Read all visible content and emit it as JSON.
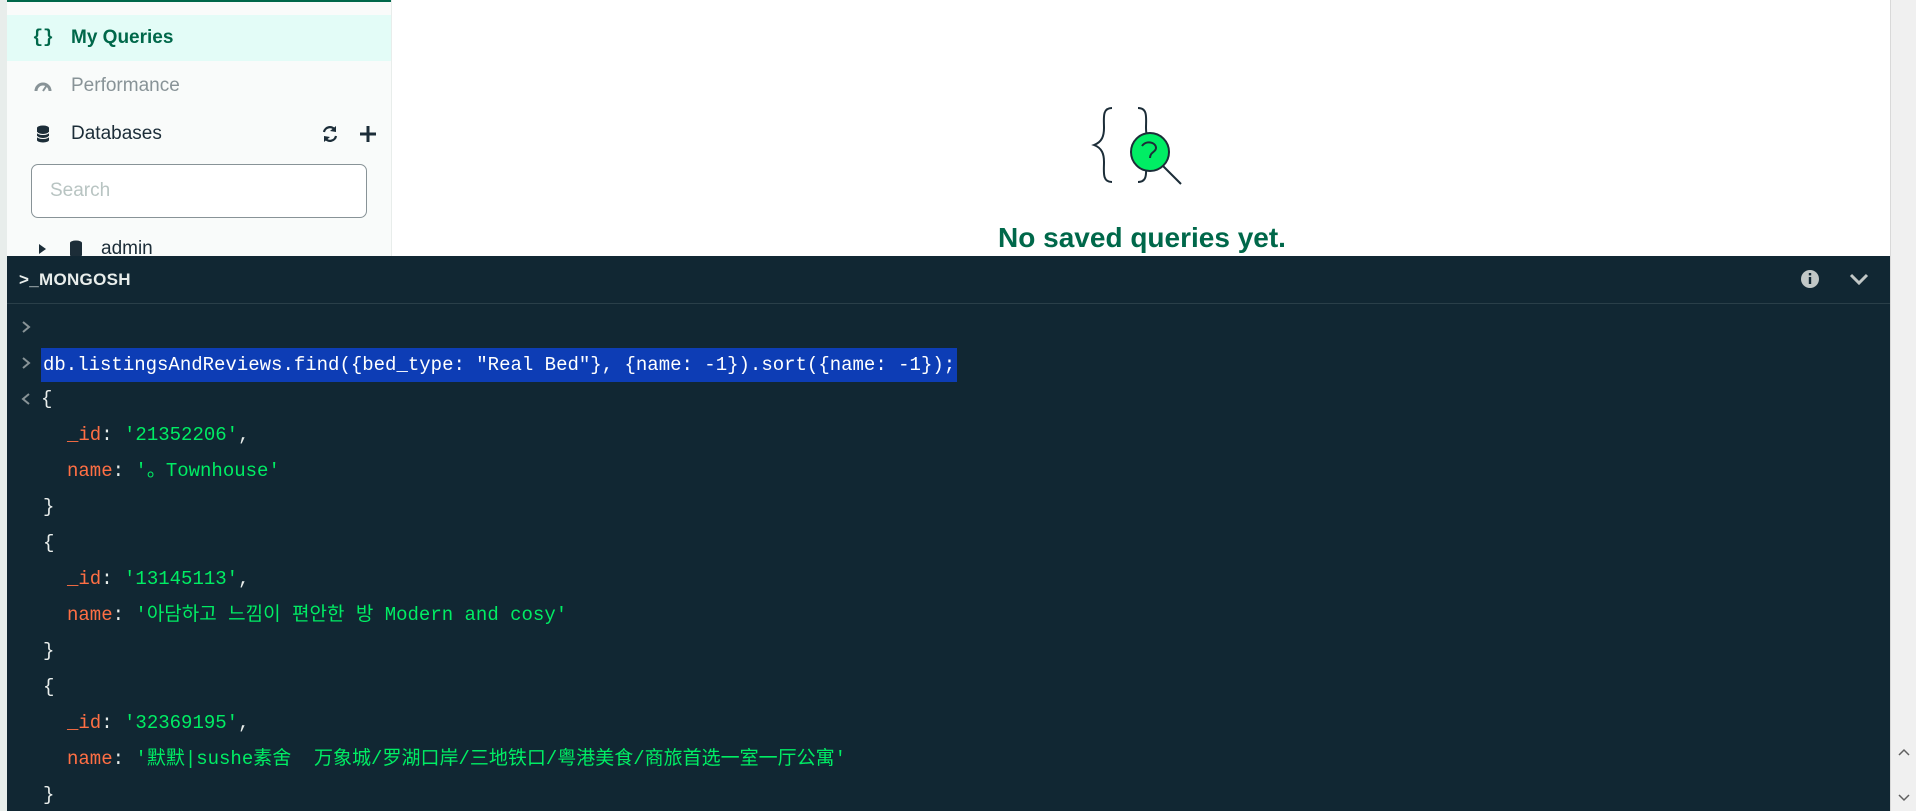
{
  "sidebar": {
    "my_queries": "My Queries",
    "performance": "Performance",
    "databases": "Databases",
    "search_placeholder": "Search",
    "tree": [
      {
        "label": "admin"
      }
    ]
  },
  "main": {
    "empty_title": "No saved queries yet."
  },
  "shell": {
    "title": ">_MONGOSH",
    "command": "db.listingsAndReviews.find({bed_type: \"Real Bed\"}, {name: -1}).sort({name: -1});",
    "open_brace": "{",
    "close_brace": "}",
    "id_key": "_id",
    "name_key": "name",
    "results": [
      {
        "_id": "'21352206'",
        "name": "'。Townhouse'"
      },
      {
        "_id": "'13145113'",
        "name": "'아담하고 느낌이 편안한 방 Modern and cosy'"
      },
      {
        "_id": "'32369195'",
        "name": "'默默|sushe素舍  万象城/罗湖口岸/三地铁口/粤港美食/商旅首选一室一厅公寓'"
      }
    ]
  },
  "colors": {
    "brand_green": "#00684a",
    "shell_bg": "#112733",
    "key_color": "#ff6f44",
    "string_color": "#00ed64",
    "selection": "#0d3db5"
  }
}
